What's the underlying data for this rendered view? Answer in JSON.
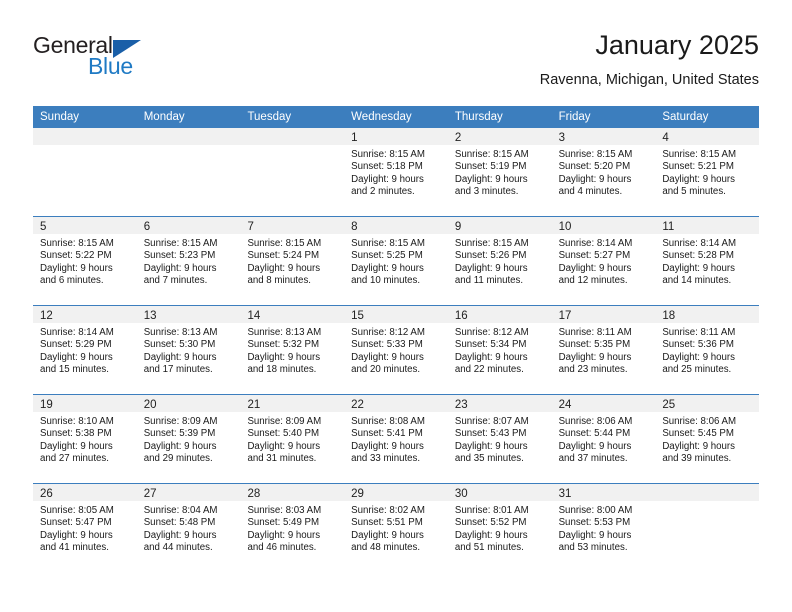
{
  "brand": {
    "name_part1": "General",
    "name_part2": "Blue",
    "triangle_icon": "triangle-logo-icon"
  },
  "header": {
    "title": "January 2025",
    "location": "Ravenna, Michigan, United States"
  },
  "colors": {
    "header_blue": "#3c7ebe",
    "day_band_gray": "#f1f1f1",
    "brand_blue": "#1f7ac4",
    "brand_dark": "#231f20"
  },
  "weekdays": [
    "Sunday",
    "Monday",
    "Tuesday",
    "Wednesday",
    "Thursday",
    "Friday",
    "Saturday"
  ],
  "weeks": [
    [
      {
        "day": "",
        "sunrise": "",
        "sunset": "",
        "daylight1": "",
        "daylight2": "",
        "empty": true
      },
      {
        "day": "",
        "sunrise": "",
        "sunset": "",
        "daylight1": "",
        "daylight2": "",
        "empty": true
      },
      {
        "day": "",
        "sunrise": "",
        "sunset": "",
        "daylight1": "",
        "daylight2": "",
        "empty": true
      },
      {
        "day": "1",
        "sunrise": "Sunrise: 8:15 AM",
        "sunset": "Sunset: 5:18 PM",
        "daylight1": "Daylight: 9 hours",
        "daylight2": "and 2 minutes."
      },
      {
        "day": "2",
        "sunrise": "Sunrise: 8:15 AM",
        "sunset": "Sunset: 5:19 PM",
        "daylight1": "Daylight: 9 hours",
        "daylight2": "and 3 minutes."
      },
      {
        "day": "3",
        "sunrise": "Sunrise: 8:15 AM",
        "sunset": "Sunset: 5:20 PM",
        "daylight1": "Daylight: 9 hours",
        "daylight2": "and 4 minutes."
      },
      {
        "day": "4",
        "sunrise": "Sunrise: 8:15 AM",
        "sunset": "Sunset: 5:21 PM",
        "daylight1": "Daylight: 9 hours",
        "daylight2": "and 5 minutes."
      }
    ],
    [
      {
        "day": "5",
        "sunrise": "Sunrise: 8:15 AM",
        "sunset": "Sunset: 5:22 PM",
        "daylight1": "Daylight: 9 hours",
        "daylight2": "and 6 minutes."
      },
      {
        "day": "6",
        "sunrise": "Sunrise: 8:15 AM",
        "sunset": "Sunset: 5:23 PM",
        "daylight1": "Daylight: 9 hours",
        "daylight2": "and 7 minutes."
      },
      {
        "day": "7",
        "sunrise": "Sunrise: 8:15 AM",
        "sunset": "Sunset: 5:24 PM",
        "daylight1": "Daylight: 9 hours",
        "daylight2": "and 8 minutes."
      },
      {
        "day": "8",
        "sunrise": "Sunrise: 8:15 AM",
        "sunset": "Sunset: 5:25 PM",
        "daylight1": "Daylight: 9 hours",
        "daylight2": "and 10 minutes."
      },
      {
        "day": "9",
        "sunrise": "Sunrise: 8:15 AM",
        "sunset": "Sunset: 5:26 PM",
        "daylight1": "Daylight: 9 hours",
        "daylight2": "and 11 minutes."
      },
      {
        "day": "10",
        "sunrise": "Sunrise: 8:14 AM",
        "sunset": "Sunset: 5:27 PM",
        "daylight1": "Daylight: 9 hours",
        "daylight2": "and 12 minutes."
      },
      {
        "day": "11",
        "sunrise": "Sunrise: 8:14 AM",
        "sunset": "Sunset: 5:28 PM",
        "daylight1": "Daylight: 9 hours",
        "daylight2": "and 14 minutes."
      }
    ],
    [
      {
        "day": "12",
        "sunrise": "Sunrise: 8:14 AM",
        "sunset": "Sunset: 5:29 PM",
        "daylight1": "Daylight: 9 hours",
        "daylight2": "and 15 minutes."
      },
      {
        "day": "13",
        "sunrise": "Sunrise: 8:13 AM",
        "sunset": "Sunset: 5:30 PM",
        "daylight1": "Daylight: 9 hours",
        "daylight2": "and 17 minutes."
      },
      {
        "day": "14",
        "sunrise": "Sunrise: 8:13 AM",
        "sunset": "Sunset: 5:32 PM",
        "daylight1": "Daylight: 9 hours",
        "daylight2": "and 18 minutes."
      },
      {
        "day": "15",
        "sunrise": "Sunrise: 8:12 AM",
        "sunset": "Sunset: 5:33 PM",
        "daylight1": "Daylight: 9 hours",
        "daylight2": "and 20 minutes."
      },
      {
        "day": "16",
        "sunrise": "Sunrise: 8:12 AM",
        "sunset": "Sunset: 5:34 PM",
        "daylight1": "Daylight: 9 hours",
        "daylight2": "and 22 minutes."
      },
      {
        "day": "17",
        "sunrise": "Sunrise: 8:11 AM",
        "sunset": "Sunset: 5:35 PM",
        "daylight1": "Daylight: 9 hours",
        "daylight2": "and 23 minutes."
      },
      {
        "day": "18",
        "sunrise": "Sunrise: 8:11 AM",
        "sunset": "Sunset: 5:36 PM",
        "daylight1": "Daylight: 9 hours",
        "daylight2": "and 25 minutes."
      }
    ],
    [
      {
        "day": "19",
        "sunrise": "Sunrise: 8:10 AM",
        "sunset": "Sunset: 5:38 PM",
        "daylight1": "Daylight: 9 hours",
        "daylight2": "and 27 minutes."
      },
      {
        "day": "20",
        "sunrise": "Sunrise: 8:09 AM",
        "sunset": "Sunset: 5:39 PM",
        "daylight1": "Daylight: 9 hours",
        "daylight2": "and 29 minutes."
      },
      {
        "day": "21",
        "sunrise": "Sunrise: 8:09 AM",
        "sunset": "Sunset: 5:40 PM",
        "daylight1": "Daylight: 9 hours",
        "daylight2": "and 31 minutes."
      },
      {
        "day": "22",
        "sunrise": "Sunrise: 8:08 AM",
        "sunset": "Sunset: 5:41 PM",
        "daylight1": "Daylight: 9 hours",
        "daylight2": "and 33 minutes."
      },
      {
        "day": "23",
        "sunrise": "Sunrise: 8:07 AM",
        "sunset": "Sunset: 5:43 PM",
        "daylight1": "Daylight: 9 hours",
        "daylight2": "and 35 minutes."
      },
      {
        "day": "24",
        "sunrise": "Sunrise: 8:06 AM",
        "sunset": "Sunset: 5:44 PM",
        "daylight1": "Daylight: 9 hours",
        "daylight2": "and 37 minutes."
      },
      {
        "day": "25",
        "sunrise": "Sunrise: 8:06 AM",
        "sunset": "Sunset: 5:45 PM",
        "daylight1": "Daylight: 9 hours",
        "daylight2": "and 39 minutes."
      }
    ],
    [
      {
        "day": "26",
        "sunrise": "Sunrise: 8:05 AM",
        "sunset": "Sunset: 5:47 PM",
        "daylight1": "Daylight: 9 hours",
        "daylight2": "and 41 minutes."
      },
      {
        "day": "27",
        "sunrise": "Sunrise: 8:04 AM",
        "sunset": "Sunset: 5:48 PM",
        "daylight1": "Daylight: 9 hours",
        "daylight2": "and 44 minutes."
      },
      {
        "day": "28",
        "sunrise": "Sunrise: 8:03 AM",
        "sunset": "Sunset: 5:49 PM",
        "daylight1": "Daylight: 9 hours",
        "daylight2": "and 46 minutes."
      },
      {
        "day": "29",
        "sunrise": "Sunrise: 8:02 AM",
        "sunset": "Sunset: 5:51 PM",
        "daylight1": "Daylight: 9 hours",
        "daylight2": "and 48 minutes."
      },
      {
        "day": "30",
        "sunrise": "Sunrise: 8:01 AM",
        "sunset": "Sunset: 5:52 PM",
        "daylight1": "Daylight: 9 hours",
        "daylight2": "and 51 minutes."
      },
      {
        "day": "31",
        "sunrise": "Sunrise: 8:00 AM",
        "sunset": "Sunset: 5:53 PM",
        "daylight1": "Daylight: 9 hours",
        "daylight2": "and 53 minutes."
      },
      {
        "day": "",
        "sunrise": "",
        "sunset": "",
        "daylight1": "",
        "daylight2": "",
        "empty": true
      }
    ]
  ]
}
